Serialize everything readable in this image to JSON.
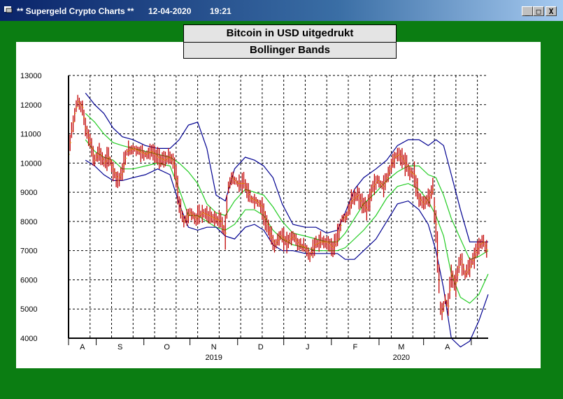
{
  "window": {
    "title": "** Supergeld Crypto Charts **",
    "date": "12-04-2020",
    "time": "19:21",
    "minimize": "_",
    "maximize": "□",
    "close": "X"
  },
  "colors": {
    "client_bg": "#0b7d12",
    "price_bar": "#c00000",
    "price_tick": "#f0c000",
    "outer_band": "#000090",
    "inner_band": "#22cc22"
  },
  "chart_data": {
    "type": "line",
    "title": "Bitcoin in USD uitgedrukt",
    "subtitle": "Bollinger Bands",
    "xlabel": "",
    "ylabel": "",
    "ylim": [
      4000,
      13000
    ],
    "yticks": [
      13000,
      12000,
      11000,
      10000,
      9000,
      8000,
      7000,
      6000,
      5000,
      4000
    ],
    "month_labels": [
      "A",
      "S",
      "O",
      "N",
      "D",
      "J",
      "F",
      "M",
      "A"
    ],
    "year_labels": [
      "2019",
      "2020"
    ],
    "grid": true,
    "x_start": "2019-07-14",
    "x_end": "2020-04-12",
    "price": [
      [
        "2019-07-14",
        10300
      ],
      [
        "2019-07-16",
        11100
      ],
      [
        "2019-07-18",
        11700
      ],
      [
        "2019-07-20",
        12100
      ],
      [
        "2019-07-23",
        11900
      ],
      [
        "2019-07-25",
        11200
      ],
      [
        "2019-07-28",
        10700
      ],
      [
        "2019-07-31",
        10100
      ],
      [
        "2019-08-03",
        10400
      ],
      [
        "2019-08-06",
        10000
      ],
      [
        "2019-08-09",
        10200
      ],
      [
        "2019-08-12",
        9800
      ],
      [
        "2019-08-15",
        9400
      ],
      [
        "2019-08-18",
        9700
      ],
      [
        "2019-08-21",
        10400
      ],
      [
        "2019-08-25",
        10500
      ],
      [
        "2019-08-29",
        10400
      ],
      [
        "2019-09-02",
        10300
      ],
      [
        "2019-09-06",
        10400
      ],
      [
        "2019-09-10",
        10200
      ],
      [
        "2019-09-14",
        10100
      ],
      [
        "2019-09-18",
        10200
      ],
      [
        "2019-09-21",
        9900
      ],
      [
        "2019-09-24",
        8600
      ],
      [
        "2019-09-27",
        8000
      ],
      [
        "2019-10-01",
        8300
      ],
      [
        "2019-10-05",
        8100
      ],
      [
        "2019-10-09",
        8300
      ],
      [
        "2019-10-13",
        8200
      ],
      [
        "2019-10-17",
        8100
      ],
      [
        "2019-10-21",
        8000
      ],
      [
        "2019-10-24",
        7600
      ],
      [
        "2019-10-26",
        9200
      ],
      [
        "2019-10-28",
        9500
      ],
      [
        "2019-11-01",
        9300
      ],
      [
        "2019-11-05",
        9300
      ],
      [
        "2019-11-09",
        8800
      ],
      [
        "2019-11-13",
        8700
      ],
      [
        "2019-11-17",
        8500
      ],
      [
        "2019-11-21",
        7700
      ],
      [
        "2019-11-25",
        7200
      ],
      [
        "2019-11-29",
        7500
      ],
      [
        "2019-12-03",
        7300
      ],
      [
        "2019-12-07",
        7500
      ],
      [
        "2019-12-11",
        7200
      ],
      [
        "2019-12-15",
        7100
      ],
      [
        "2019-12-18",
        6800
      ],
      [
        "2019-12-21",
        7200
      ],
      [
        "2019-12-25",
        7300
      ],
      [
        "2019-12-29",
        7300
      ],
      [
        "2020-01-02",
        7100
      ],
      [
        "2020-01-05",
        7400
      ],
      [
        "2020-01-08",
        8100
      ],
      [
        "2020-01-11",
        8200
      ],
      [
        "2020-01-14",
        8700
      ],
      [
        "2020-01-18",
        8900
      ],
      [
        "2020-01-21",
        8600
      ],
      [
        "2020-01-24",
        8400
      ],
      [
        "2020-01-28",
        9200
      ],
      [
        "2020-01-31",
        9400
      ],
      [
        "2020-02-04",
        9200
      ],
      [
        "2020-02-08",
        9800
      ],
      [
        "2020-02-11",
        10200
      ],
      [
        "2020-02-14",
        10300
      ],
      [
        "2020-02-18",
        10000
      ],
      [
        "2020-02-21",
        9700
      ],
      [
        "2020-02-24",
        9600
      ],
      [
        "2020-02-27",
        8800
      ],
      [
        "2020-03-01",
        8600
      ],
      [
        "2020-03-04",
        8800
      ],
      [
        "2020-03-07",
        9100
      ],
      [
        "2020-03-09",
        7900
      ],
      [
        "2020-03-12",
        5000
      ],
      [
        "2020-03-13",
        4900
      ],
      [
        "2020-03-15",
        5300
      ],
      [
        "2020-03-17",
        5100
      ],
      [
        "2020-03-19",
        6200
      ],
      [
        "2020-03-22",
        5900
      ],
      [
        "2020-03-25",
        6700
      ],
      [
        "2020-03-28",
        6200
      ],
      [
        "2020-03-31",
        6400
      ],
      [
        "2020-04-03",
        6800
      ],
      [
        "2020-04-06",
        7200
      ],
      [
        "2020-04-09",
        7300
      ],
      [
        "2020-04-12",
        6900
      ]
    ],
    "series": [
      {
        "points": [
          [
            "2019-07-25",
            12400
          ],
          [
            "2019-07-31",
            12000
          ],
          [
            "2019-08-06",
            11700
          ],
          [
            "2019-08-12",
            11200
          ],
          [
            "2019-08-18",
            10900
          ],
          [
            "2019-08-25",
            10800
          ],
          [
            "2019-09-02",
            10600
          ],
          [
            "2019-09-10",
            10500
          ],
          [
            "2019-09-18",
            10500
          ],
          [
            "2019-09-24",
            10800
          ],
          [
            "2019-09-30",
            11300
          ],
          [
            "2019-10-06",
            11400
          ],
          [
            "2019-10-12",
            10500
          ],
          [
            "2019-10-18",
            8900
          ],
          [
            "2019-10-24",
            8700
          ],
          [
            "2019-10-30",
            9800
          ],
          [
            "2019-11-06",
            10200
          ],
          [
            "2019-11-12",
            10100
          ],
          [
            "2019-11-18",
            9900
          ],
          [
            "2019-11-24",
            9500
          ],
          [
            "2019-11-30",
            8600
          ],
          [
            "2019-12-07",
            7900
          ],
          [
            "2019-12-15",
            7800
          ],
          [
            "2019-12-22",
            7800
          ],
          [
            "2019-12-29",
            7600
          ],
          [
            "2020-01-05",
            7700
          ],
          [
            "2020-01-10",
            8300
          ],
          [
            "2020-01-16",
            9100
          ],
          [
            "2020-01-22",
            9500
          ],
          [
            "2020-01-30",
            9800
          ],
          [
            "2020-02-06",
            10100
          ],
          [
            "2020-02-13",
            10600
          ],
          [
            "2020-02-20",
            10800
          ],
          [
            "2020-02-27",
            10800
          ],
          [
            "2020-03-04",
            10600
          ],
          [
            "2020-03-09",
            10800
          ],
          [
            "2020-03-14",
            10600
          ],
          [
            "2020-03-19",
            9600
          ],
          [
            "2020-03-25",
            8400
          ],
          [
            "2020-03-31",
            7300
          ],
          [
            "2020-04-06",
            7300
          ],
          [
            "2020-04-12",
            7300
          ]
        ]
      },
      {
        "points": [
          [
            "2019-07-25",
            11700
          ],
          [
            "2019-07-31",
            11400
          ],
          [
            "2019-08-06",
            11000
          ],
          [
            "2019-08-12",
            10700
          ],
          [
            "2019-08-18",
            10600
          ],
          [
            "2019-08-25",
            10500
          ],
          [
            "2019-09-02",
            10400
          ],
          [
            "2019-09-10",
            10300
          ],
          [
            "2019-09-18",
            10200
          ],
          [
            "2019-09-24",
            10000
          ],
          [
            "2019-09-30",
            9700
          ],
          [
            "2019-10-06",
            9300
          ],
          [
            "2019-10-12",
            8600
          ],
          [
            "2019-10-18",
            8300
          ],
          [
            "2019-10-24",
            8200
          ],
          [
            "2019-10-30",
            8700
          ],
          [
            "2019-11-06",
            9100
          ],
          [
            "2019-11-12",
            9000
          ],
          [
            "2019-11-18",
            8900
          ],
          [
            "2019-11-24",
            8500
          ],
          [
            "2019-11-30",
            8000
          ],
          [
            "2019-12-07",
            7600
          ],
          [
            "2019-12-15",
            7500
          ],
          [
            "2019-12-22",
            7400
          ],
          [
            "2019-12-29",
            7300
          ],
          [
            "2020-01-05",
            7300
          ],
          [
            "2020-01-10",
            7600
          ],
          [
            "2020-01-16",
            8100
          ],
          [
            "2020-01-22",
            8600
          ],
          [
            "2020-01-30",
            9000
          ],
          [
            "2020-02-06",
            9400
          ],
          [
            "2020-02-13",
            9700
          ],
          [
            "2020-02-20",
            9900
          ],
          [
            "2020-02-27",
            9900
          ],
          [
            "2020-03-04",
            9600
          ],
          [
            "2020-03-09",
            9500
          ],
          [
            "2020-03-14",
            8900
          ],
          [
            "2020-03-19",
            8100
          ],
          [
            "2020-03-25",
            7400
          ],
          [
            "2020-03-31",
            6700
          ],
          [
            "2020-04-06",
            6800
          ],
          [
            "2020-04-12",
            7000
          ]
        ]
      },
      {
        "points": [
          [
            "2019-07-25",
            10800
          ],
          [
            "2019-07-31",
            10400
          ],
          [
            "2019-08-06",
            10200
          ],
          [
            "2019-08-12",
            10100
          ],
          [
            "2019-08-18",
            9800
          ],
          [
            "2019-08-25",
            9800
          ],
          [
            "2019-09-02",
            9900
          ],
          [
            "2019-09-10",
            10000
          ],
          [
            "2019-09-18",
            9900
          ],
          [
            "2019-09-24",
            9100
          ],
          [
            "2019-09-30",
            8200
          ],
          [
            "2019-10-06",
            8200
          ],
          [
            "2019-10-12",
            8000
          ],
          [
            "2019-10-18",
            7800
          ],
          [
            "2019-10-24",
            7700
          ],
          [
            "2019-10-30",
            7900
          ],
          [
            "2019-11-06",
            8400
          ],
          [
            "2019-11-12",
            8400
          ],
          [
            "2019-11-18",
            8200
          ],
          [
            "2019-11-24",
            7700
          ],
          [
            "2019-11-30",
            7400
          ],
          [
            "2019-12-07",
            7200
          ],
          [
            "2019-12-15",
            7100
          ],
          [
            "2019-12-22",
            7000
          ],
          [
            "2019-12-29",
            7000
          ],
          [
            "2020-01-05",
            7000
          ],
          [
            "2020-01-10",
            7100
          ],
          [
            "2020-01-16",
            7400
          ],
          [
            "2020-01-22",
            7700
          ],
          [
            "2020-01-30",
            8200
          ],
          [
            "2020-02-06",
            8800
          ],
          [
            "2020-02-13",
            9200
          ],
          [
            "2020-02-20",
            9300
          ],
          [
            "2020-02-27",
            9100
          ],
          [
            "2020-03-04",
            8700
          ],
          [
            "2020-03-09",
            8200
          ],
          [
            "2020-03-14",
            7500
          ],
          [
            "2020-03-19",
            6200
          ],
          [
            "2020-03-25",
            5400
          ],
          [
            "2020-03-31",
            5200
          ],
          [
            "2020-04-06",
            5500
          ],
          [
            "2020-04-12",
            6200
          ]
        ]
      },
      {
        "points": [
          [
            "2019-07-25",
            10100
          ],
          [
            "2019-07-31",
            9900
          ],
          [
            "2019-08-06",
            9600
          ],
          [
            "2019-08-12",
            9400
          ],
          [
            "2019-08-18",
            9400
          ],
          [
            "2019-08-25",
            9500
          ],
          [
            "2019-09-02",
            9600
          ],
          [
            "2019-09-10",
            9800
          ],
          [
            "2019-09-18",
            9600
          ],
          [
            "2019-09-24",
            8600
          ],
          [
            "2019-09-30",
            7800
          ],
          [
            "2019-10-06",
            7700
          ],
          [
            "2019-10-12",
            7800
          ],
          [
            "2019-10-18",
            7800
          ],
          [
            "2019-10-24",
            7500
          ],
          [
            "2019-10-30",
            7400
          ],
          [
            "2019-11-06",
            7800
          ],
          [
            "2019-11-12",
            7900
          ],
          [
            "2019-11-18",
            7700
          ],
          [
            "2019-11-24",
            7200
          ],
          [
            "2019-11-30",
            7000
          ],
          [
            "2019-12-07",
            7000
          ],
          [
            "2019-12-15",
            6900
          ],
          [
            "2019-12-22",
            6900
          ],
          [
            "2019-12-29",
            6900
          ],
          [
            "2020-01-05",
            6900
          ],
          [
            "2020-01-10",
            6700
          ],
          [
            "2020-01-16",
            6700
          ],
          [
            "2020-01-22",
            7000
          ],
          [
            "2020-01-30",
            7400
          ],
          [
            "2020-02-06",
            8000
          ],
          [
            "2020-02-13",
            8600
          ],
          [
            "2020-02-20",
            8700
          ],
          [
            "2020-02-27",
            8400
          ],
          [
            "2020-03-04",
            7900
          ],
          [
            "2020-03-09",
            7000
          ],
          [
            "2020-03-14",
            5700
          ],
          [
            "2020-03-19",
            4000
          ],
          [
            "2020-03-25",
            3700
          ],
          [
            "2020-03-31",
            3900
          ],
          [
            "2020-04-06",
            4600
          ],
          [
            "2020-04-12",
            5500
          ]
        ]
      }
    ]
  }
}
